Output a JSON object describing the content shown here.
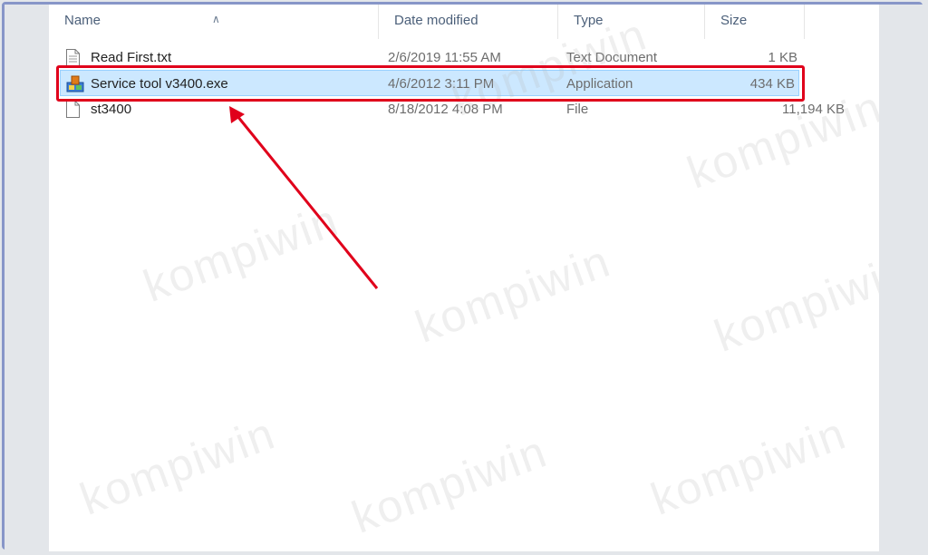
{
  "columns": {
    "name": "Name",
    "date_modified": "Date modified",
    "type": "Type",
    "size": "Size"
  },
  "files": [
    {
      "name": "Read First.txt",
      "date": "2/6/2019 11:55 AM",
      "type": "Text Document",
      "size": "1 KB",
      "icon": "text-file-icon"
    },
    {
      "name": "Service tool v3400.exe",
      "date": "4/6/2012 3:11 PM",
      "type": "Application",
      "size": "434 KB",
      "icon": "application-icon"
    },
    {
      "name": "st3400",
      "date": "8/18/2012 4:08 PM",
      "type": "File",
      "size": "11,194 KB",
      "icon": "blank-file-icon"
    }
  ],
  "watermark": "kompiwin",
  "colors": {
    "highlight": "#e0001b",
    "selection_bg": "#cce8ff",
    "frame": "#8796c8"
  }
}
